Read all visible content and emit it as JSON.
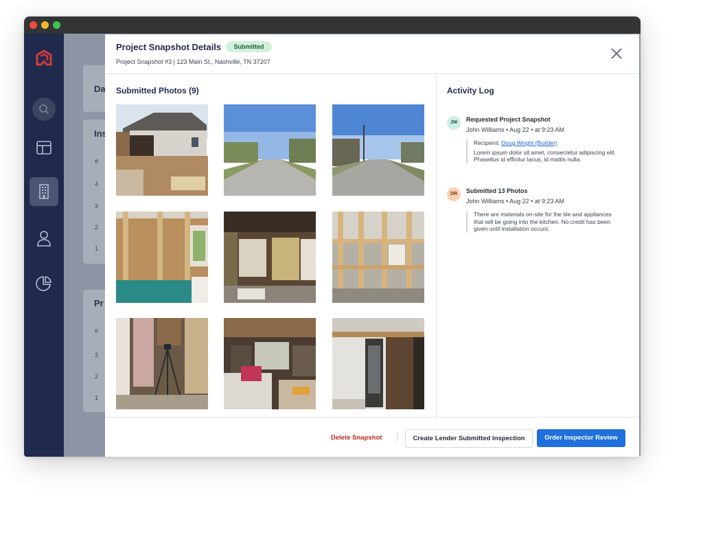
{
  "background_page": {
    "card1_title": "Da",
    "card2_title": "Ins",
    "card2_header": "#",
    "card2_rows": [
      "4",
      "3",
      "2",
      "1"
    ],
    "card3_title": "Pr",
    "card3_header": "#",
    "card3_rows": [
      "3",
      "2",
      "1"
    ]
  },
  "sidebar": {
    "items": [
      {
        "icon": "logo-icon"
      },
      {
        "icon": "search-icon"
      },
      {
        "icon": "layout-icon"
      },
      {
        "icon": "building-icon",
        "active": true
      },
      {
        "icon": "user-icon"
      },
      {
        "icon": "pie-chart-icon"
      }
    ]
  },
  "modal": {
    "title": "Project Snapshot Details",
    "status_badge": "Submitted",
    "subtitle": "Project Snapshot #3 | 123 Main St., Nashville, TN 37207",
    "photos_title": "Submitted Photos (9)",
    "activity_title": "Activity Log",
    "activity": [
      {
        "initials": "JW",
        "title": "Requested Project Snapshot",
        "meta": "John Williams • Aug 22 • at 9:23 AM",
        "recipient_label": "Recipient: ",
        "recipient_link": "Doug Wright (Builder)",
        "body": "Lorem ipsum dolor sit amet, consectetur adipiscing elit. Phasellus id efficitur lacus, id mattis nulla."
      },
      {
        "initials": "DR",
        "title": "Submitted 13 Photos",
        "meta": "John Williams • Aug 22 • at 9:23 AM",
        "body": "There are materials on-site for the tile and appliances that will be going into the kitchen. No credit has been given until installation occurs."
      }
    ],
    "footer": {
      "delete_label": "Delete Snapshot",
      "secondary_label": "Create Lender Submitted Inspection",
      "primary_label": "Order Inspector Review"
    }
  },
  "colors": {
    "sidebar": "#1f2a4d",
    "accent": "#1f6fdc",
    "danger": "#c0271f",
    "badge_bg": "#d3f0dc",
    "avatar_jw": "#cdeee6",
    "avatar_dr": "#fbd1b4"
  }
}
